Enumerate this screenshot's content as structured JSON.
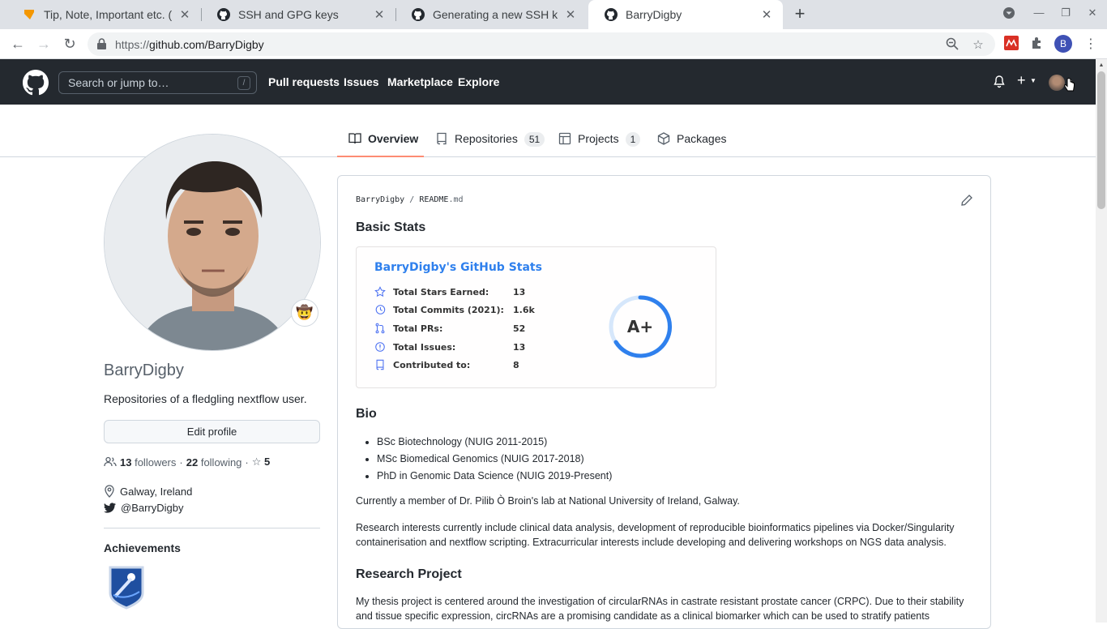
{
  "browser": {
    "tabs": [
      {
        "title": "Tip, Note, Important etc. (",
        "icon": "typo3-icon"
      },
      {
        "title": "SSH and GPG keys",
        "icon": "github-icon"
      },
      {
        "title": "Generating a new SSH key",
        "icon": "github-icon"
      },
      {
        "title": "BarryDigby",
        "icon": "github-icon"
      }
    ],
    "url_proto": "https://",
    "url_rest": "github.com/BarryDigby",
    "profile_initial": "B"
  },
  "header": {
    "search_placeholder": "Search or jump to…",
    "search_shortcut": "/",
    "nav": [
      "Pull requests",
      "Issues",
      "Marketplace",
      "Explore"
    ]
  },
  "profile_tabs": [
    {
      "label": "Overview"
    },
    {
      "label": "Repositories",
      "count": "51"
    },
    {
      "label": "Projects",
      "count": "1"
    },
    {
      "label": "Packages"
    }
  ],
  "sidebar": {
    "username": "BarryDigby",
    "bio": "Repositories of a fledgling nextflow user.",
    "edit_button": "Edit profile",
    "followers_count": "13",
    "followers_label": "followers",
    "following_count": "22",
    "following_label": "following",
    "stars_count": "5",
    "location": "Galway, Ireland",
    "twitter": "@BarryDigby",
    "achievements_title": "Achievements"
  },
  "readme": {
    "path_owner": "BarryDigby",
    "path_sep": "/",
    "path_file": "README",
    "path_ext": ".md",
    "basic_stats_heading": "Basic Stats",
    "stats_card": {
      "title": "BarryDigby's GitHub Stats",
      "rows": [
        {
          "label": "Total Stars Earned:",
          "value": "13"
        },
        {
          "label": "Total Commits (2021):",
          "value": "1.6k"
        },
        {
          "label": "Total PRs:",
          "value": "52"
        },
        {
          "label": "Total Issues:",
          "value": "13"
        },
        {
          "label": "Contributed to:",
          "value": "8"
        }
      ],
      "rank": "A+"
    },
    "bio_heading": "Bio",
    "bio_items": [
      "BSc Biotechnology (NUIG 2011-2015)",
      "MSc Biomedical Genomics (NUIG 2017-2018)",
      "PhD in Genomic Data Science (NUIG 2019-Present)"
    ],
    "member_text": "Currently a member of Dr. Pilib Ò Broin's lab at National University of Ireland, Galway.",
    "interests_text": "Research interests currently include clinical data analysis, development of reproducible bioinformatics pipelines via Docker/Singularity containerisation and nextflow scripting. Extracurricular interests include developing and delivering workshops on NGS data analysis.",
    "project_heading": "Research Project",
    "project_text": "My thesis project is centered around the investigation of circularRNAs in castrate resistant prostate cancer (CRPC). Due to their stability and tissue specific expression, circRNAs are a promising candidate as a clinical biomarker which can be used to stratify patients"
  },
  "colors": {
    "header_bg": "#24292f",
    "stats_title": "#2f80ed",
    "tab_underline": "#fd8c73"
  }
}
